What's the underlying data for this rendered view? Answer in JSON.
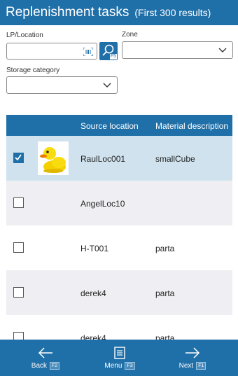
{
  "header": {
    "title": "Replenishment tasks",
    "subtitle": "(First 300 results)"
  },
  "filters": {
    "lp_location": {
      "label": "LP/Location",
      "value": ""
    },
    "search": {
      "key_hint": "F5"
    },
    "zone": {
      "label": "Zone",
      "value": ""
    },
    "storage_category": {
      "label": "Storage category",
      "value": ""
    }
  },
  "table": {
    "columns": [
      "Source location",
      "Material description"
    ],
    "rows": [
      {
        "checked": true,
        "source": "RaulLoc001",
        "material": "smallCube",
        "has_image": true
      },
      {
        "checked": false,
        "source": "AngelLoc10",
        "material": "",
        "has_image": false
      },
      {
        "checked": false,
        "source": "H-T001",
        "material": "parta",
        "has_image": false
      },
      {
        "checked": false,
        "source": "derek4",
        "material": "parta",
        "has_image": false
      },
      {
        "checked": false,
        "source": "derek4",
        "material": "parta",
        "has_image": false
      }
    ]
  },
  "footer": {
    "back": {
      "label": "Back",
      "key": "F2"
    },
    "menu": {
      "label": "Menu",
      "key": "F3"
    },
    "next": {
      "label": "Next",
      "key": "F1"
    }
  },
  "colors": {
    "accent": "#1f6fa8",
    "selected_row": "#cfe2ee",
    "alt_row": "#efeff3"
  }
}
